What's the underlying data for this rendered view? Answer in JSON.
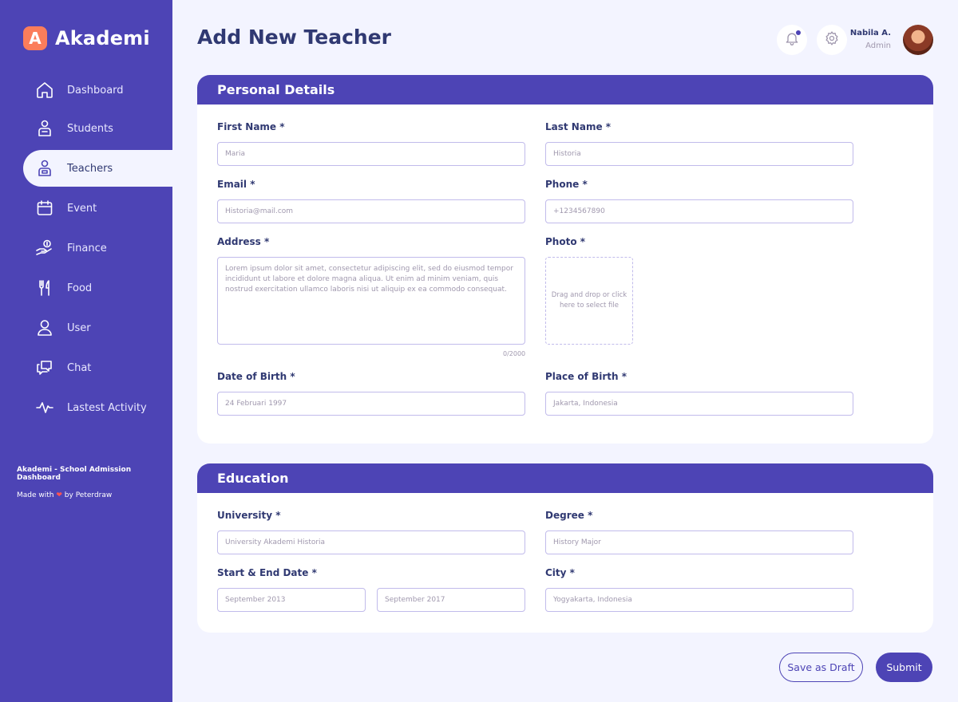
{
  "app": {
    "logo_letter": "A",
    "name": "Akademi"
  },
  "sidebar": {
    "items": [
      {
        "label": "Dashboard",
        "icon": "home-icon",
        "active": false
      },
      {
        "label": "Students",
        "icon": "student-icon",
        "active": false
      },
      {
        "label": "Teachers",
        "icon": "teacher-icon",
        "active": true
      },
      {
        "label": "Event",
        "icon": "calendar-icon",
        "active": false
      },
      {
        "label": "Finance",
        "icon": "finance-icon",
        "active": false
      },
      {
        "label": "Food",
        "icon": "food-icon",
        "active": false
      },
      {
        "label": "User",
        "icon": "user-icon",
        "active": false
      },
      {
        "label": "Chat",
        "icon": "chat-icon",
        "active": false
      },
      {
        "label": "Lastest Activity",
        "icon": "activity-icon",
        "active": false
      }
    ],
    "footer_title": "Akademi - School Admission Dashboard",
    "footer_made_prefix": "Made with",
    "footer_heart": "❤",
    "footer_made_suffix": "by Peterdraw"
  },
  "header": {
    "title": "Add New Teacher",
    "user_name": "Nabila A.",
    "user_role": "Admin"
  },
  "personal": {
    "section_title": "Personal Details",
    "first_name_label": "First Name *",
    "first_name_placeholder": "Maria",
    "last_name_label": "Last Name *",
    "last_name_placeholder": "Historia",
    "email_label": "Email *",
    "email_placeholder": "Historia@mail.com",
    "phone_label": "Phone *",
    "phone_placeholder": "+1234567890",
    "address_label": "Address *",
    "address_placeholder": "Lorem ipsum dolor sit amet, consectetur adipiscing elit, sed do eiusmod tempor incididunt ut labore et dolore magna aliqua. Ut enim ad minim veniam, quis nostrud exercitation ullamco laboris nisi ut aliquip ex ea commodo consequat.",
    "address_counter": "0/2000",
    "photo_label": "Photo *",
    "photo_drop_text": "Drag and drop or click here to select file",
    "dob_label": "Date of Birth *",
    "dob_placeholder": "24 Februari 1997",
    "pob_label": "Place of Birth *",
    "pob_placeholder": "Jakarta, Indonesia"
  },
  "education": {
    "section_title": "Education",
    "university_label": "University *",
    "university_placeholder": "University Akademi Historia",
    "degree_label": "Degree *",
    "degree_placeholder": "History Major",
    "dates_label": "Start & End Date *",
    "start_placeholder": "September 2013",
    "end_placeholder": "September 2017",
    "city_label": "City *",
    "city_placeholder": "Yogyakarta, Indonesia"
  },
  "actions": {
    "draft_label": "Save as Draft",
    "submit_label": "Submit"
  },
  "colors": {
    "primary": "#4D44B5",
    "accent": "#FB7D5B",
    "text": "#303972",
    "muted": "#A098AE",
    "background": "#F3F4FF"
  }
}
